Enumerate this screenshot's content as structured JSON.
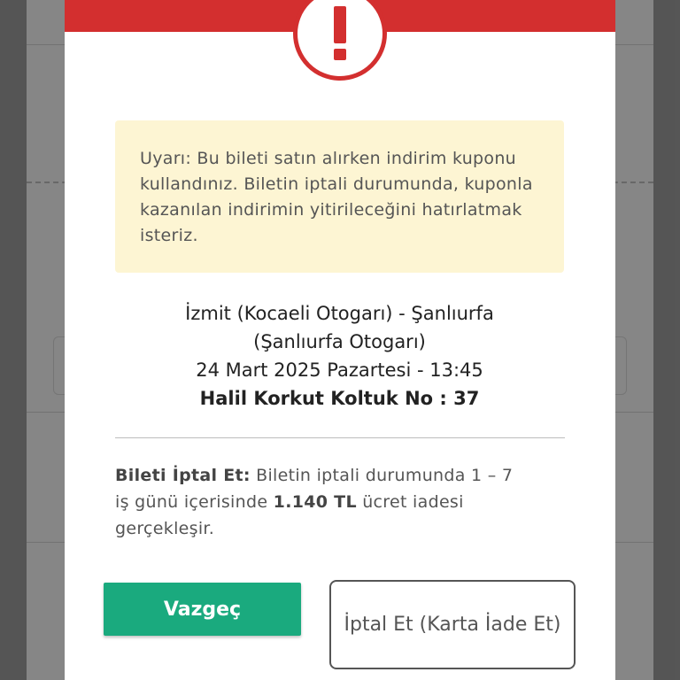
{
  "colors": {
    "header_red": "#d32f2f",
    "warning_bg": "#fdf5d3",
    "primary_green": "#1aaa7e",
    "overlay": "rgba(0,0,0,0.38)"
  },
  "icons": {
    "alert": "exclamation-mark-in-circle"
  },
  "modal": {
    "warning_text": "Uyarı: Bu bileti satın alırken indirim kuponu kullandınız. Biletin iptali durumunda, kuponla kazanılan indirimin yitirileceğini hatırlatmak isteriz.",
    "trip": {
      "route_line1": "İzmit (Kocaeli Otogarı) - Şanlıurfa",
      "route_line2": "(Şanlıurfa Otogarı)",
      "datetime": "24 Mart 2025 Pazartesi - 13:45",
      "passenger_seat": "Halil Korkut Koltuk No : 37"
    },
    "cancel_info": {
      "label": "Bileti İptal Et:",
      "text_before": " Biletin iptali durumunda 1 – 7 iş günü içerisinde ",
      "amount": "1.140 TL",
      "text_after": " ücret iadesi gerçekleşir."
    },
    "buttons": {
      "dismiss_label": "Vazgeç",
      "cancel_refund_label": "İptal Et (Karta İade Et)"
    }
  }
}
